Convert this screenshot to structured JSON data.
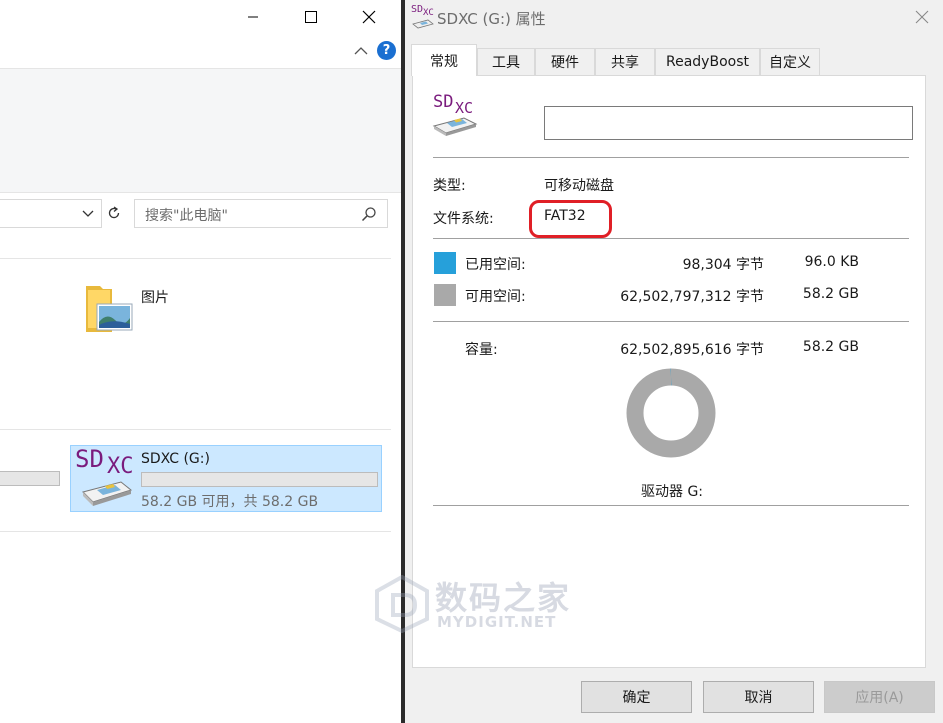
{
  "explorer": {
    "search_placeholder": "搜索\"此电脑\"",
    "folder_pictures_label": "图片",
    "drive": {
      "logo_sd": "SD",
      "logo_xc": "XC",
      "name": "SDXC (G:)",
      "space_text": "58.2 GB 可用，共 58.2 GB",
      "used_fraction": 0.0
    },
    "help_icon_glyph": "?"
  },
  "dialog": {
    "title": "SDXC (G:) 属性",
    "title_icon_sd": "SD",
    "title_icon_xc": "XC",
    "tabs": [
      "常规",
      "工具",
      "硬件",
      "共享",
      "ReadyBoost",
      "自定义"
    ],
    "active_tab": "常规",
    "drive_icon_sd": "SD",
    "drive_icon_xc": "XC",
    "name_value": "",
    "type_label": "类型:",
    "type_value": "可移动磁盘",
    "fs_label": "文件系统:",
    "fs_value": "FAT32",
    "used_label": "已用空间:",
    "used_bytes": "98,304 字节",
    "used_size": "96.0 KB",
    "free_label": "可用空间:",
    "free_bytes": "62,502,797,312 字节",
    "free_size": "58.2 GB",
    "capacity_label": "容量:",
    "capacity_bytes": "62,502,895,616 字节",
    "capacity_size": "58.2 GB",
    "drive_caption": "驱动器 G:",
    "used_fraction": 1.6e-06,
    "colors": {
      "used": "#26a0da",
      "free": "#a9a9a9",
      "highlight": "#e01f26"
    },
    "buttons": {
      "ok": "确定",
      "cancel": "取消",
      "apply": "应用(A)"
    }
  },
  "watermark": {
    "cn": "数码之家",
    "en": "MYDIGIT.NET"
  }
}
